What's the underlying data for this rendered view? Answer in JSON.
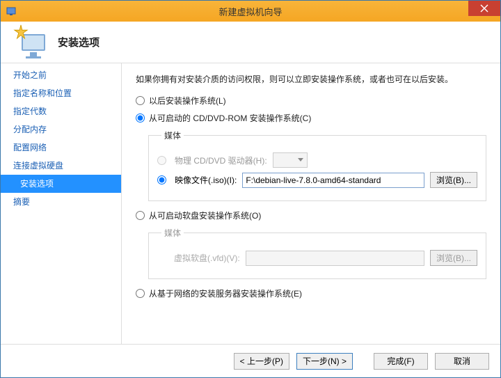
{
  "window": {
    "title": "新建虚拟机向导"
  },
  "header": {
    "title": "安装选项"
  },
  "sidebar": {
    "items": [
      {
        "label": "开始之前"
      },
      {
        "label": "指定名称和位置"
      },
      {
        "label": "指定代数"
      },
      {
        "label": "分配内存"
      },
      {
        "label": "配置网络"
      },
      {
        "label": "连接虚拟硬盘"
      },
      {
        "label": "安装选项"
      },
      {
        "label": "摘要"
      }
    ],
    "active_index": 6
  },
  "content": {
    "intro": "如果你拥有对安装介质的访问权限，则可以立即安装操作系统，或者也可在以后安装。",
    "opt_later": "以后安装操作系统(L)",
    "opt_cddvd": "从可启动的 CD/DVD-ROM 安装操作系统(C)",
    "media_legend": "媒体",
    "opt_physical": "物理 CD/DVD 驱动器(H):",
    "opt_iso": "映像文件(.iso)(I):",
    "iso_path": "F:\\debian-live-7.8.0-amd64-standard",
    "browse": "浏览(B)...",
    "opt_floppy": "从可启动软盘安装操作系统(O)",
    "vfd_label": "虚拟软盘(.vfd)(V):",
    "opt_network": "从基于网络的安装服务器安装操作系统(E)"
  },
  "footer": {
    "prev": "< 上一步(P)",
    "next": "下一步(N) >",
    "finish": "完成(F)",
    "cancel": "取消"
  }
}
